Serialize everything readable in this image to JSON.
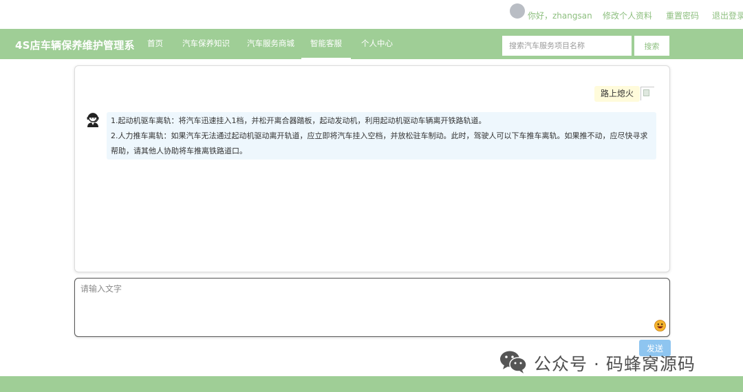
{
  "userbar": {
    "greeting": "你好，zhangsan",
    "edit_profile": "修改个人资料",
    "reset_password": "重置密码",
    "logout": "退出登录"
  },
  "nav": {
    "brand": "4S店车辆保养维护管理系",
    "items": [
      {
        "label": "首页"
      },
      {
        "label": "汽车保养知识"
      },
      {
        "label": "汽车服务商城"
      },
      {
        "label": "智能客服",
        "active": true
      },
      {
        "label": "个人中心"
      }
    ],
    "search_placeholder": "搜索汽车服务项目名称",
    "search_button": "搜索"
  },
  "chat": {
    "user_message": "路上熄火",
    "bot_message": {
      "line1": "1.起动机驱车离轨：将汽车迅速挂入1档，并松开离合器踏板，起动发动机，利用起动机驱动车辆离开铁路轨道。",
      "line2": "2.人力推车离轨：如果汽车无法通过起动机驱动离开轨道，应立即将汽车挂入空档，并放松驻车制动。此时，驾驶人可以下车推车离轨。如果推不动，应尽快寻求帮助，请其他人协助将车推离铁路道口。"
    }
  },
  "composer": {
    "placeholder": "请输入文字",
    "send_button": "发送"
  },
  "watermark": {
    "text": "公众号 · 码蜂窝源码"
  },
  "colors": {
    "brand_green": "#9fce96",
    "link_green": "#8dbf7f",
    "send_blue": "#8ec5f0",
    "bot_bubble": "#eef7fd",
    "user_bubble": "#fffbdb"
  },
  "icons": {
    "bot_avatar": "customer-service-agent-icon",
    "emoji": "smiley-emoji-icon",
    "user_avatar": "broken-image-icon",
    "watermark": "wechat-icon"
  }
}
